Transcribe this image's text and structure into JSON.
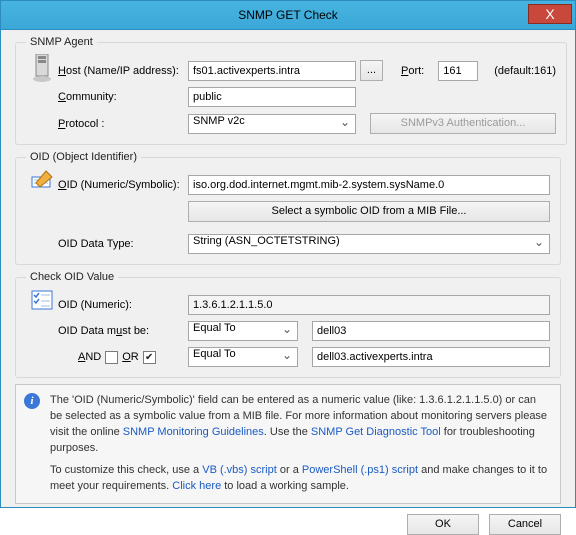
{
  "window": {
    "title": "SNMP GET Check",
    "close": "X"
  },
  "agent": {
    "legend": "SNMP Agent",
    "host_label_pre": "H",
    "host_label_rest": "ost (Name/IP address):",
    "host_value": "fs01.activexperts.intra",
    "browse": "...",
    "port_label_pre": "P",
    "port_label_rest": "ort:",
    "port_value": "161",
    "default_hint": "(default:161)",
    "community_label_pre": "C",
    "community_label_rest": "ommunity:",
    "community_value": "public",
    "protocol_label_pre": "P",
    "protocol_label_rest": "rotocol :",
    "protocol_value": "SNMP v2c",
    "auth_btn": "SNMPv3 Authentication..."
  },
  "oid": {
    "legend": "OID (Object Identifier)",
    "oid_label_pre": "O",
    "oid_label_rest": "ID (Numeric/Symbolic):",
    "oid_value": "iso.org.dod.internet.mgmt.mib-2.system.sysName.0",
    "select_btn": "Select a symbolic OID from a MIB File...",
    "type_label": "OID Data Type:",
    "type_value": "String (ASN_OCTETSTRING)"
  },
  "check": {
    "legend": "Check OID Value",
    "numeric_label": "OID (Numeric):",
    "numeric_value": "1.3.6.1.2.1.1.5.0",
    "must_label": "OID Data m",
    "must_u": "u",
    "must_rest": "st be:",
    "op1": "Equal To",
    "val1": "dell03",
    "and_pre": "A",
    "and_rest": "ND",
    "or_pre": "O",
    "or_rest": "R",
    "op2": "Equal To",
    "val2": "dell03.activexperts.intra"
  },
  "info": {
    "p1a": "The 'OID (Numeric/Symbolic)' field can be entered as a numeric value (like: 1.3.6.1.2.1.1.5.0) or can be selected as a symbolic value from a MIB file. For more information about  monitoring servers please visit the online ",
    "link1": "SNMP Monitoring Guidelines",
    "p1b": ". Use the ",
    "link2": "SNMP Get Diagnostic Tool",
    "p1c": " for troubleshooting purposes.",
    "p2a": "To customize this check, use a ",
    "link3": "VB (.vbs) script",
    "p2b": "  or a ",
    "link4": "PowerShell (.ps1) script",
    "p2c": " and make changes to it to meet your requirements. ",
    "link5": "Click here",
    "p2d": " to load a working sample."
  },
  "buttons": {
    "ok": "OK",
    "cancel": "Cancel"
  }
}
